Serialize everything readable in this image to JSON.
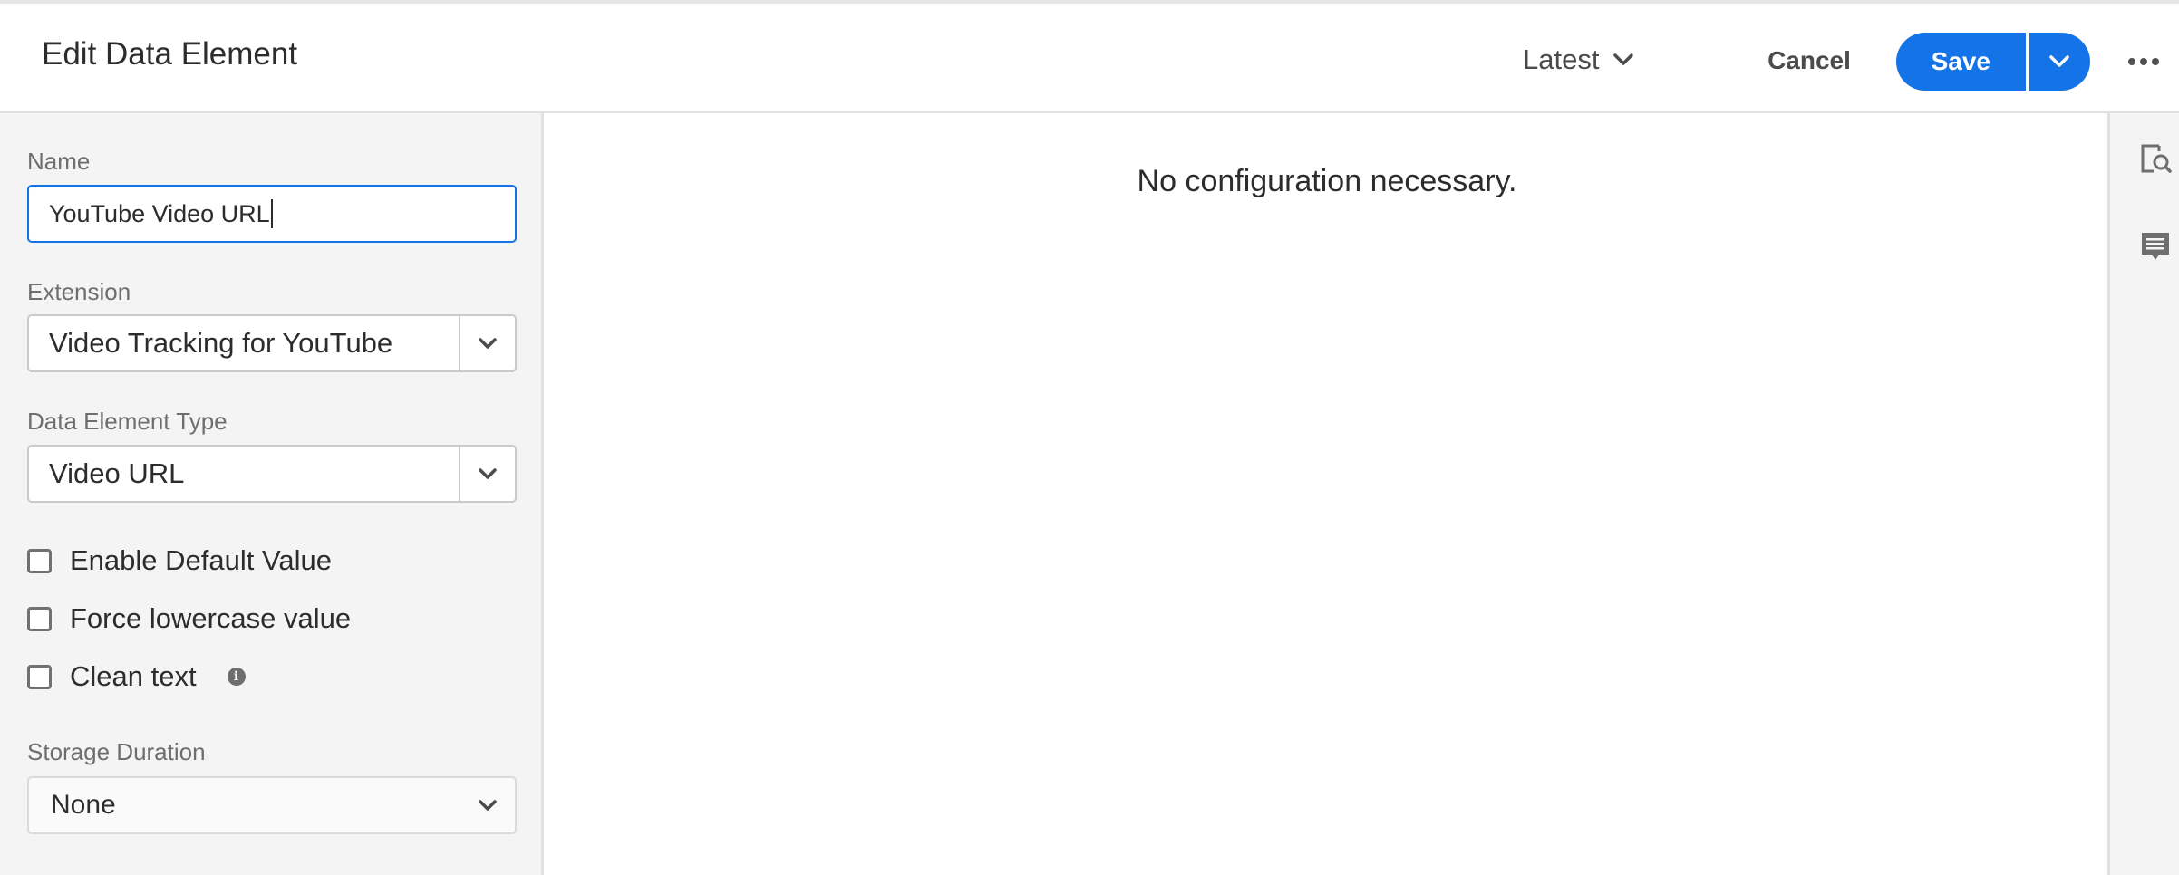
{
  "header": {
    "title": "Edit Data Element",
    "version_label": "Latest",
    "cancel_label": "Cancel",
    "save_label": "Save"
  },
  "form": {
    "name": {
      "label": "Name",
      "value": "YouTube Video URL"
    },
    "extension": {
      "label": "Extension",
      "value": "Video Tracking for YouTube"
    },
    "data_element_type": {
      "label": "Data Element Type",
      "value": "Video URL"
    },
    "checkboxes": [
      {
        "label": "Enable Default Value",
        "checked": false
      },
      {
        "label": "Force lowercase value",
        "checked": false
      },
      {
        "label": "Clean text",
        "checked": false
      }
    ],
    "storage_duration": {
      "label": "Storage Duration",
      "value": "None"
    }
  },
  "main": {
    "message": "No configuration necessary."
  },
  "colors": {
    "accent": "#1473e6",
    "panel": "#f4f4f4",
    "border": "#cacaca"
  },
  "icons": [
    "chevron-down-icon",
    "more-icon",
    "info-icon",
    "preview-search-icon",
    "comment-icon"
  ]
}
